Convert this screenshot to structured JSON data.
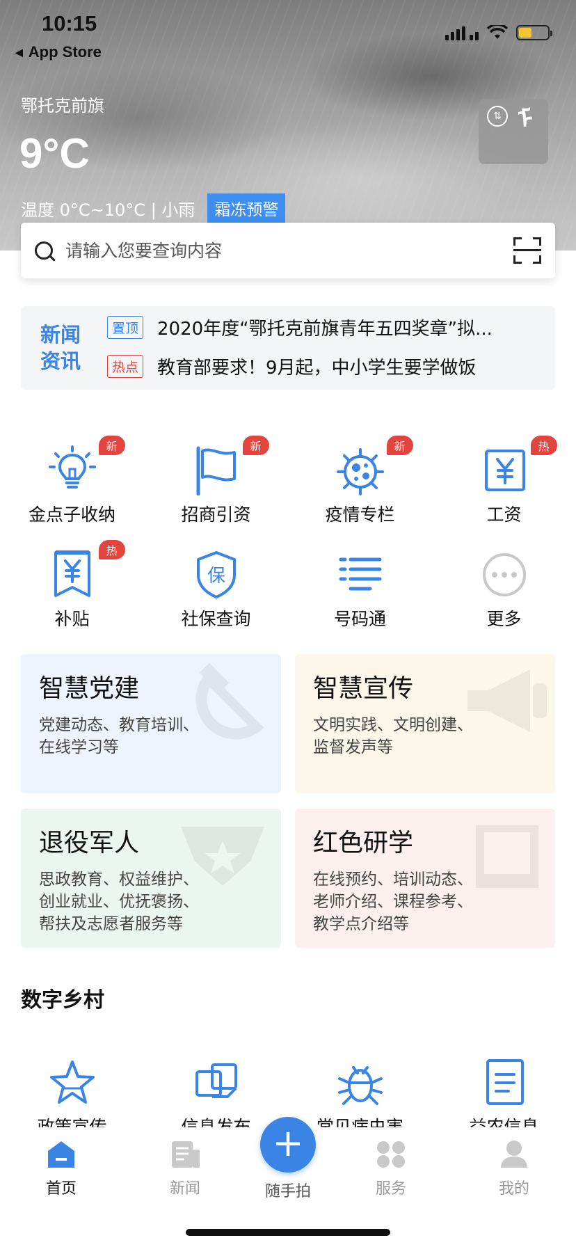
{
  "status_bar": {
    "time": "10:15",
    "back_label": "App Store"
  },
  "weather": {
    "city": "鄂托克前旗",
    "temperature": "9°C",
    "detail": "温度 0°C~10°C | 小雨",
    "warning": "霜冻预警"
  },
  "search": {
    "placeholder": "请输入您要查询内容"
  },
  "news": {
    "title_line1": "新闻",
    "title_line2": "资讯",
    "items": [
      {
        "tag": "置顶",
        "text": "2020年度“鄂托克前旗青年五四奖章”拟..."
      },
      {
        "tag": "热点",
        "text": "教育部要求！9月起，中小学生要学做饭"
      }
    ]
  },
  "services": [
    {
      "label": "金点子收纳",
      "badge": "新",
      "icon": "lightbulb-icon"
    },
    {
      "label": "招商引资",
      "badge": "新",
      "icon": "flag-icon"
    },
    {
      "label": "疫情专栏",
      "badge": "新",
      "icon": "virus-icon"
    },
    {
      "label": "工资",
      "badge": "热",
      "icon": "yen-card-icon"
    },
    {
      "label": "补贴",
      "badge": "热",
      "icon": "yen-bookmark-icon"
    },
    {
      "label": "社保查询",
      "badge": "",
      "icon": "shield-bao-icon"
    },
    {
      "label": "号码通",
      "badge": "",
      "icon": "list-icon"
    },
    {
      "label": "更多",
      "badge": "",
      "icon": "more-icon"
    }
  ],
  "cards": [
    {
      "title": "智慧党建",
      "desc": "党建动态、教育培训、在线学习等"
    },
    {
      "title": "智慧宣传",
      "desc": "文明实践、文明创建、监督发声等"
    },
    {
      "title": "退役军人",
      "desc": "思政教育、权益维护、创业就业、优抚褒扬、帮扶及志愿者服务等"
    },
    {
      "title": "红色研学",
      "desc": "在线预约、培训动态、老师介绍、课程参考、教学点介绍等"
    }
  ],
  "digital_village": {
    "title": "数字乡村",
    "items": [
      {
        "label": "政策宣传",
        "icon": "star-icon"
      },
      {
        "label": "信息发布",
        "icon": "share-squares-icon"
      },
      {
        "label": "常见病虫害",
        "icon": "bug-icon"
      },
      {
        "label": "益农信息",
        "icon": "document-icon"
      }
    ]
  },
  "tabbar": {
    "home": "首页",
    "news": "新闻",
    "snap": "随手拍",
    "services": "服务",
    "mine": "我的"
  },
  "colors": {
    "accent": "#3a84e6",
    "badge": "#e4443e"
  }
}
